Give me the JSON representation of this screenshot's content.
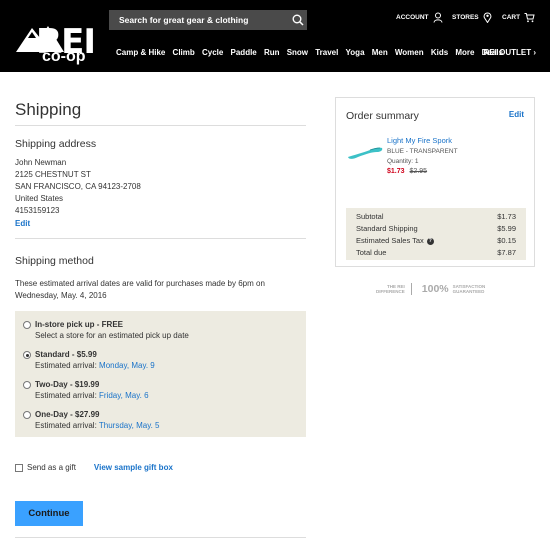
{
  "header": {
    "logo": "REI",
    "logo_sub": "co-op",
    "search_placeholder": "Search for great gear & clothing",
    "account": "ACCOUNT",
    "stores": "STORES",
    "cart": "CART",
    "nav": [
      "Camp & Hike",
      "Climb",
      "Cycle",
      "Paddle",
      "Run",
      "Snow",
      "Travel",
      "Yoga",
      "Men",
      "Women",
      "Kids",
      "More",
      "Deals"
    ],
    "outlet": "REI OUTLET ›"
  },
  "page": {
    "title": "Shipping"
  },
  "address": {
    "title": "Shipping address",
    "lines": [
      "John Newman",
      "2125 CHESTNUT ST",
      "SAN FRANCISCO, CA 94123-2708",
      "United States",
      "4153159123"
    ],
    "edit": "Edit"
  },
  "method": {
    "title": "Shipping method",
    "note": "These estimated arrival dates are valid for purchases made by 6pm on Wednesday, May. 4, 2016",
    "options": [
      {
        "title": "In-store pick up - FREE",
        "sub": "Select a store for an estimated pick up date",
        "date": "",
        "selected": false
      },
      {
        "title": "Standard - $5.99",
        "sub": "Estimated arrival: ",
        "date": "Monday, May. 9",
        "selected": true
      },
      {
        "title": "Two-Day - $19.99",
        "sub": "Estimated arrival: ",
        "date": "Friday, May. 6",
        "selected": false
      },
      {
        "title": "One-Day - $27.99",
        "sub": "Estimated arrival: ",
        "date": "Thursday, May. 5",
        "selected": false
      }
    ]
  },
  "gift": {
    "label": "Send as a gift",
    "link": "View sample gift box"
  },
  "continue_label": "Continue",
  "summary": {
    "title": "Order summary",
    "edit": "Edit",
    "product": {
      "name": "Light My Fire Spork",
      "color": "BLUE - TRANSPARENT",
      "qty": "Quantity: 1",
      "price": "$1.73",
      "orig_price": "$2.95"
    },
    "totals": [
      {
        "label": "Subtotal",
        "value": "$1.73"
      },
      {
        "label": "Standard Shipping",
        "value": "$5.99"
      },
      {
        "label": "Estimated Sales Tax",
        "value": "$0.15"
      },
      {
        "label": "Total due",
        "value": "$7.87"
      }
    ]
  },
  "guarantee": {
    "left_top": "THE REI",
    "left_bottom": "DIFFERENCE",
    "big": "100%",
    "right_top": "SATISFACTION",
    "right_bottom": "GUARANTEED"
  },
  "colors": {
    "link": "#1a73c9",
    "sale": "#d0021b",
    "button": "#3aa1ff",
    "panel": "#edebe1"
  }
}
